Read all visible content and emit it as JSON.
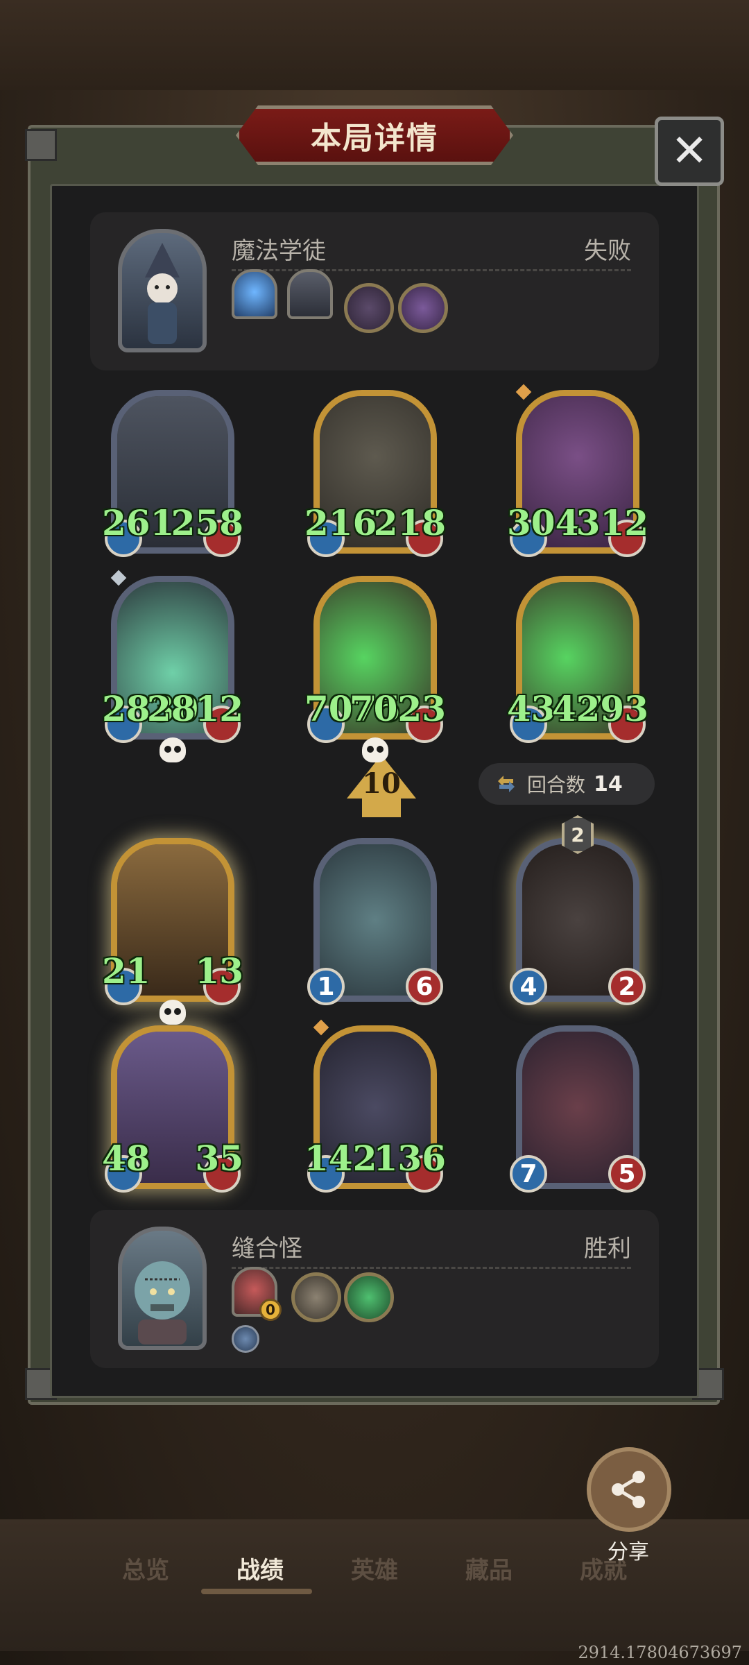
{
  "title": "本局详情",
  "close_label": "✕",
  "player_top": {
    "name": "魔法学徒",
    "result": "失败"
  },
  "player_bottom": {
    "name": "缝合怪",
    "result": "胜利",
    "relic_count": "0"
  },
  "round_marker": "10",
  "turns": {
    "label": "回合数",
    "value": "14"
  },
  "enemy_units": [
    {
      "atk": "261",
      "hp": "258",
      "frame": "blue"
    },
    {
      "atk": "216",
      "hp": "218",
      "frame": "gold"
    },
    {
      "atk": "304",
      "hp": "312",
      "frame": "gold"
    },
    {
      "atk": "2830",
      "hp": "2812",
      "frame": "blue"
    },
    {
      "atk": "7075",
      "hp": "7023",
      "frame": "gold"
    },
    {
      "atk": "4317",
      "hp": "4293",
      "frame": "gold"
    }
  ],
  "ally_units": [
    {
      "atk": "21",
      "hp": "13",
      "frame": "gold"
    },
    {
      "atk": "1",
      "hp": "6",
      "frame": "blue"
    },
    {
      "atk": "4",
      "hp": "2",
      "frame": "blue",
      "level": "2"
    },
    {
      "atk": "48",
      "hp": "35",
      "frame": "gold"
    },
    {
      "atk": "142",
      "hp": "136",
      "frame": "gold"
    },
    {
      "atk": "7",
      "hp": "5",
      "frame": "blue"
    }
  ],
  "share_label": "分享",
  "nav": [
    "总览",
    "战绩",
    "英雄",
    "藏品",
    "成就"
  ],
  "version": "2914.17804673697",
  "colors": {
    "title_red": "#7a1b17",
    "gold_frame": "#c39336",
    "blue_frame": "#596176",
    "boost_green": "#9df08b",
    "atk_blue": "#2d6aa6",
    "hp_red": "#a52d2d"
  }
}
